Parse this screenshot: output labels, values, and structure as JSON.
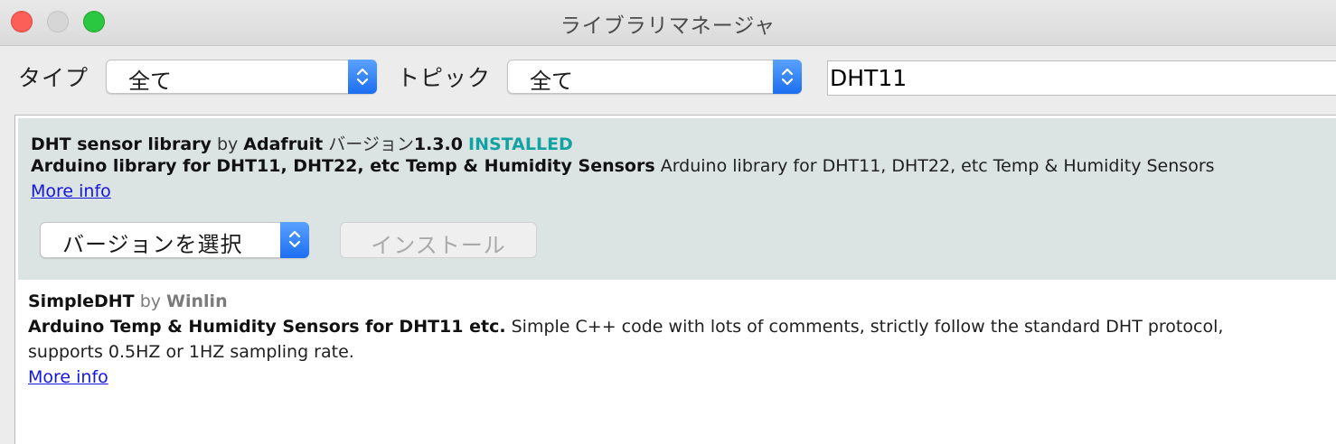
{
  "window": {
    "title": "ライブラリマネージャ"
  },
  "toolbar": {
    "type_label": "タイプ",
    "type_value": "全て",
    "topic_label": "トピック",
    "topic_value": "全て",
    "search_value": "DHT11"
  },
  "libraries": [
    {
      "name": "DHT sensor library",
      "by": "by",
      "author": "Adafruit",
      "version_prefix": "バージョン",
      "version": "1.3.0",
      "status": "INSTALLED",
      "sentence": "Arduino library for DHT11, DHT22, etc Temp & Humidity Sensors",
      "paragraph": "Arduino library for DHT11, DHT22, etc Temp & Humidity Sensors",
      "more_info": "More info",
      "version_select": "バージョンを選択",
      "install_button": "インストール"
    },
    {
      "name": "SimpleDHT",
      "by": "by",
      "author": "Winlin",
      "sentence": "Arduino Temp & Humidity Sensors for DHT11 etc.",
      "paragraph_line1": "Simple C++ code with lots of comments, strictly follow the standard DHT protocol,",
      "paragraph_line2": "supports 0.5HZ or 1HZ sampling rate.",
      "more_info": "More info"
    }
  ],
  "colors": {
    "selected_row": "#dce3e3",
    "installed": "#11a2a2",
    "link": "#1515e0",
    "stepper": "#1c6ef1"
  }
}
